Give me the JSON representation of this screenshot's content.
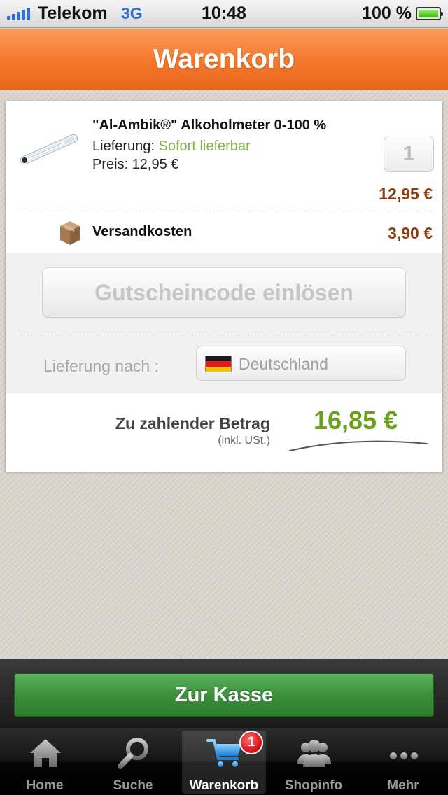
{
  "status_bar": {
    "carrier": "Telekom",
    "network": "3G",
    "time": "10:48",
    "battery_percent": "100 %"
  },
  "nav": {
    "title": "Warenkorb"
  },
  "cart": {
    "item": {
      "name": "\"Al-Ambik®\" Alkoholmeter 0-100 %",
      "delivery_label": "Lieferung:",
      "delivery_status": "Sofort lieferbar",
      "price_line": "Preis: 12,95 €",
      "quantity": "1",
      "line_total": "12,95 €"
    },
    "shipping": {
      "label": "Versandkosten",
      "cost": "3,90 €"
    },
    "voucher_button": "Gutscheincode einlösen",
    "delivery_to": {
      "label": "Lieferung nach :",
      "country": "Deutschland"
    },
    "total": {
      "label": "Zu zahlender Betrag",
      "note": "(inkl. USt.)",
      "amount": "16,85 €"
    }
  },
  "checkout_button": "Zur Kasse",
  "tabs": [
    {
      "label": "Home",
      "icon": "home-icon"
    },
    {
      "label": "Suche",
      "icon": "search-icon"
    },
    {
      "label": "Warenkorb",
      "icon": "cart-icon",
      "active": true,
      "badge": "1"
    },
    {
      "label": "Shopinfo",
      "icon": "people-icon"
    },
    {
      "label": "Mehr",
      "icon": "more-icon"
    }
  ],
  "colors": {
    "nav_orange": "#f4782c",
    "in_stock_green": "#7fb34b",
    "price_brown": "#8c3d12",
    "total_green": "#6aa01a",
    "checkout_green": "#3c8f3c",
    "badge_red": "#d10f0f"
  }
}
